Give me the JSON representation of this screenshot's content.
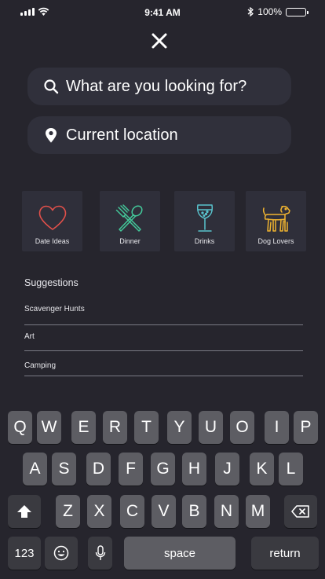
{
  "status_bar": {
    "time": "9:41 AM",
    "battery": "100%"
  },
  "search": {
    "placeholder": "What are you looking for?"
  },
  "location": {
    "value": "Current location"
  },
  "categories": [
    {
      "label": "Date Ideas",
      "icon": "heart-icon",
      "color": "#e2504a"
    },
    {
      "label": "Dinner",
      "icon": "utensils-icon",
      "color": "#43c89a"
    },
    {
      "label": "Drinks",
      "icon": "wine-glass-icon",
      "color": "#59c3cd"
    },
    {
      "label": "Dog Lovers",
      "icon": "dog-icon",
      "color": "#f0b430"
    }
  ],
  "suggestions": {
    "title": "Suggestions",
    "items": [
      "Scavenger Hunts",
      "Art",
      "Camping"
    ]
  },
  "keyboard": {
    "row1": [
      "Q",
      "W",
      "E",
      "R",
      "T",
      "Y",
      "U",
      "O",
      "I",
      "P"
    ],
    "row2": [
      "A",
      "S",
      "D",
      "F",
      "G",
      "H",
      "J",
      "K",
      "L"
    ],
    "row3": [
      "Z",
      "X",
      "C",
      "V",
      "B",
      "N",
      "M"
    ],
    "numbers_label": "123",
    "space_label": "space",
    "return_label": "return"
  }
}
